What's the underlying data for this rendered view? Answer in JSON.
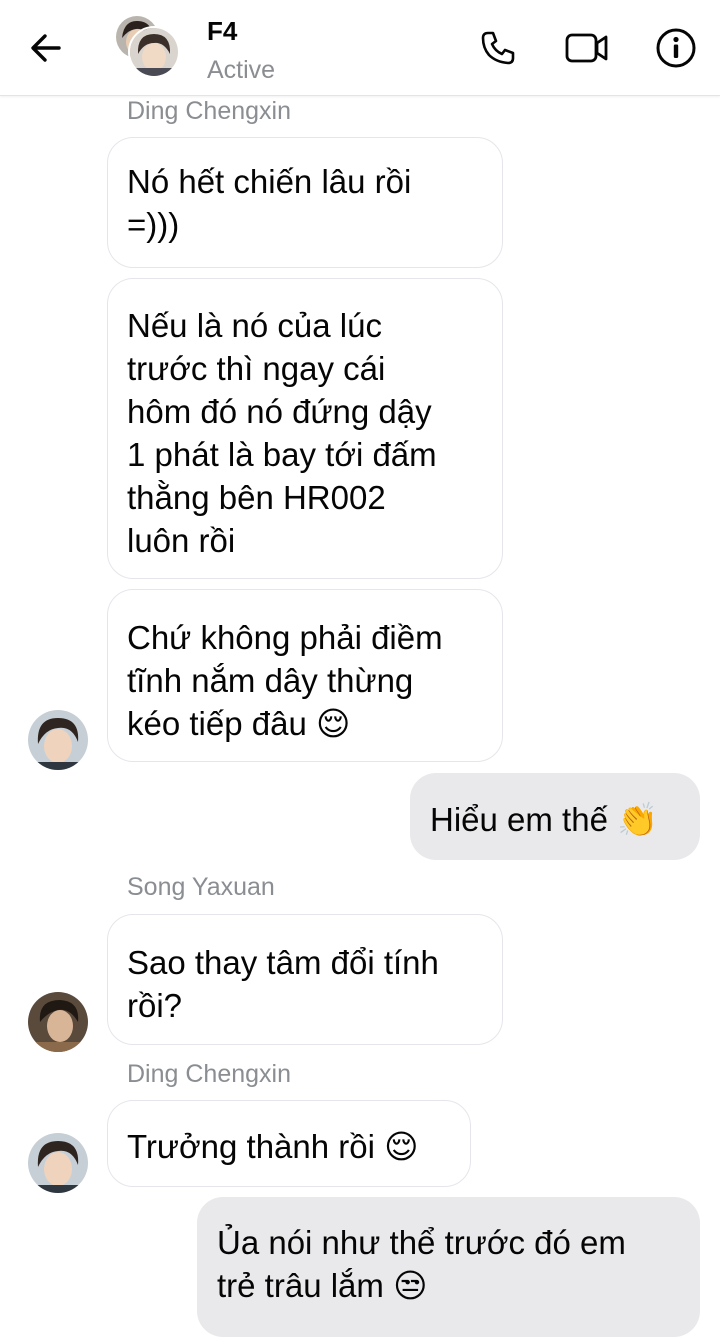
{
  "header": {
    "title": "F4",
    "status": "Active",
    "back_icon": "arrow-left-icon",
    "call_icon": "phone-icon",
    "video_icon": "video-camera-icon",
    "info_icon": "info-icon"
  },
  "messages": [
    {
      "sender": "Ding Chengxin",
      "text": "Nó hết chiến lâu rồi\n=)))"
    },
    {
      "text": "Nếu là nó của lúc\ntrước thì ngay cái\nhôm đó nó đứng dậy\n1 phát là bay tới đấm\nthằng bên HR002\nluôn rồi"
    },
    {
      "text": "Chứ không phải điềm\ntĩnh nắm dây thừng\nkéo tiếp đâu",
      "emoji": "😌"
    },
    {
      "text": "Hiểu em thế",
      "emoji": "👏"
    },
    {
      "sender": "Song Yaxuan",
      "text": "Sao thay tâm đổi tính\nrồi?"
    },
    {
      "sender": "Ding Chengxin",
      "text": "Trưởng thành rồi",
      "emoji": "😌"
    },
    {
      "text": "Ủa nói như thể trước đó em\ntrẻ trâu lắm",
      "emoji": "😒"
    }
  ],
  "colors": {
    "incoming_bubble": "#ffffff",
    "outgoing_bubble": "#e9e9eb",
    "muted_text": "#8a8d91"
  }
}
